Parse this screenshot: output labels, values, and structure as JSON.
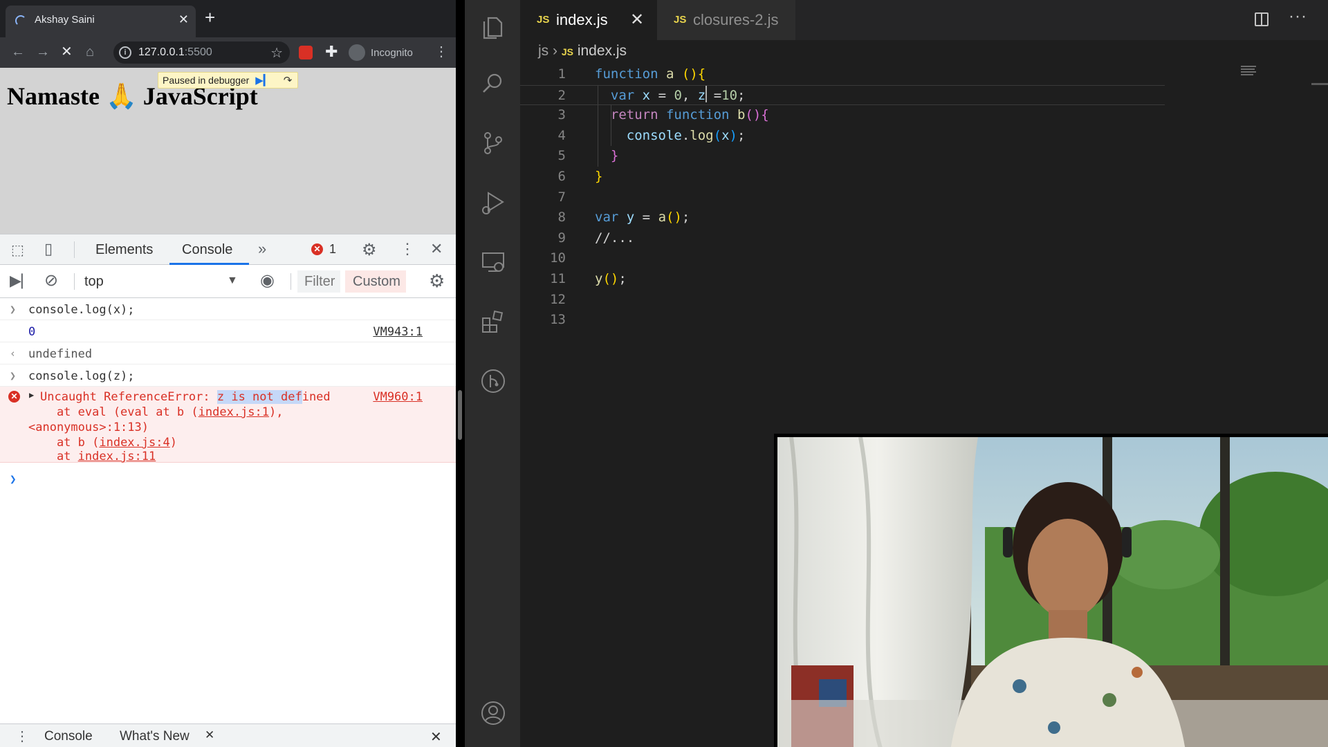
{
  "browser": {
    "tab_title": "Akshay Saini",
    "url_host": "127.0.0.1",
    "url_port": ":5500",
    "incognito_label": "Incognito",
    "page_heading": "Namaste 🙏 JavaScript",
    "debugger_banner": "Paused in debugger"
  },
  "devtools": {
    "tabs": [
      "Elements",
      "Console"
    ],
    "error_count": "1",
    "context": "top",
    "filter_placeholder": "Filter",
    "levels_label": "Custom",
    "console": [
      {
        "kind": "input",
        "text": "console.log(x);"
      },
      {
        "kind": "output",
        "text": "0",
        "source": "VM943:1"
      },
      {
        "kind": "return",
        "text": "undefined"
      },
      {
        "kind": "input",
        "text": "console.log(z);"
      }
    ],
    "error": {
      "prefix": "Uncaught ReferenceError: ",
      "highlight": "z is not def",
      "suffix": "ined",
      "source": "VM960:1",
      "stack": [
        {
          "before": "    at eval (eval at b (",
          "link": "index.js:1",
          "after": "),"
        },
        {
          "before": "<anonymous>:1:13)",
          "link": "",
          "after": ""
        },
        {
          "before": "    at b (",
          "link": "index.js:4",
          "after": ")"
        },
        {
          "before": "    at ",
          "link": "index.js:11",
          "after": ""
        }
      ]
    },
    "drawer_tabs": [
      "Console",
      "What's New"
    ]
  },
  "editor": {
    "tabs": [
      {
        "label": "index.js",
        "active": true
      },
      {
        "label": "closures-2.js",
        "active": false
      }
    ],
    "breadcrumb": [
      "js",
      "index.js"
    ],
    "lines": [
      "function a (){",
      "  var x = 0, z =10;",
      "  return function b(){",
      "    console.log(x);",
      "  }",
      "}",
      "",
      "var y = a();",
      "//...",
      "",
      "y();",
      "",
      ""
    ]
  },
  "colors": {
    "keyword": "#569cd6",
    "function": "#dcdcaa",
    "variable": "#9cdcfe",
    "number": "#b5cea8",
    "comment": "#6a9955",
    "error": "#d93025",
    "devtools_accent": "#1a73e8"
  },
  "icons": [
    "explorer-icon",
    "search-icon",
    "source-control-icon",
    "run-debug-icon",
    "remote-explorer-icon",
    "extensions-icon",
    "git-graph-icon",
    "account-icon"
  ]
}
